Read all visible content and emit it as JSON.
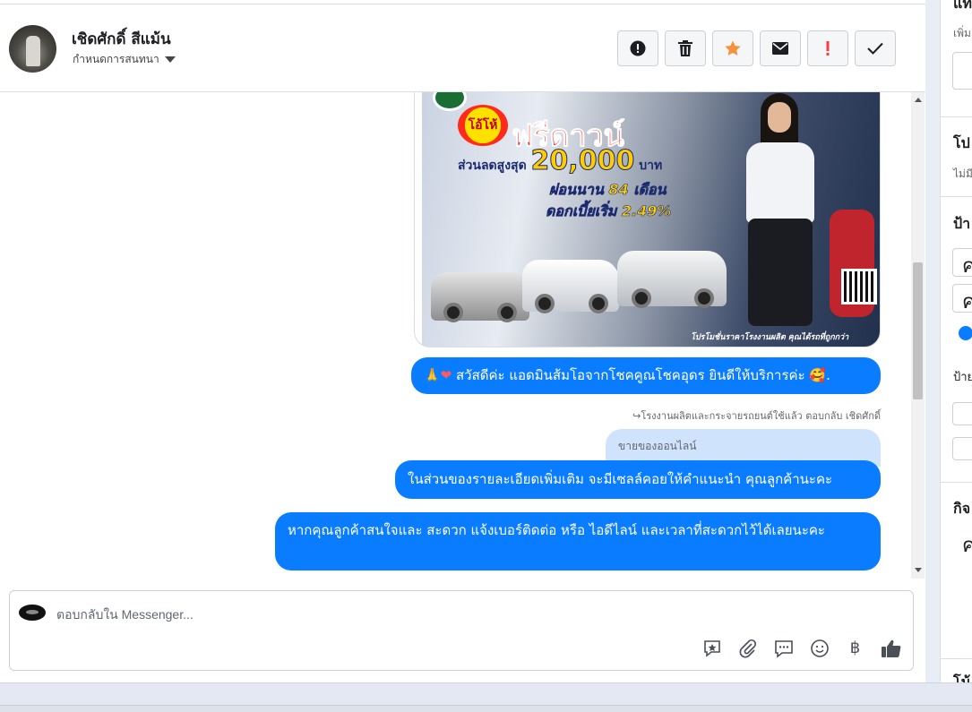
{
  "header": {
    "contact_name": "เชิดศักดิ์ สีแม้น",
    "assign_label": "กำหนดการสนทนา",
    "actions": [
      {
        "name": "report-button",
        "icon": "alert-circle-icon"
      },
      {
        "name": "delete-button",
        "icon": "trash-icon"
      },
      {
        "name": "star-button",
        "icon": "star-icon"
      },
      {
        "name": "mark-unread-button",
        "icon": "envelope-icon"
      },
      {
        "name": "follow-up-button",
        "icon": "exclamation-icon"
      },
      {
        "name": "done-button",
        "icon": "checkmark-icon"
      }
    ]
  },
  "promo": {
    "free_down_tag": "โอ้โห้",
    "headline": "ฟรีดาวน์",
    "discount_label": "ส่วนลดสูงสุด",
    "discount_amount": "20,000",
    "discount_unit": "บาท",
    "installment": "ผ่อนนาน 84 เดือน",
    "interest": "ดอกเบี้ยเริ่ม 2.49%",
    "footer": "โปรโมชั่นราคาโรงงานผลิต คุณได้รถที่ถูกกว่า"
  },
  "messages": {
    "greeting_emoji": "🙏❤",
    "greeting": "สวัสดีค่ะ แอดมินส้มโอจากโชคคูณโชคอุดร ยินดีให้บริการค่ะ",
    "greeting_end": "🥰.",
    "reply_meta": "↪โรงงานผลิตและกระจายรถยนต์ใช้แล้ว ตอบกลับ เชิดศักดิ์",
    "quoted_text": "ขายของออนไลน์",
    "msg2": "ในส่วนของรายละเอียดเพิ่มเติม จะมีเซลล์คอยให้คำแนะนำ คุณลูกค้านะคะ",
    "msg3": "หากคุณลูกค้าสนใจและ สะดวก แจ้งเบอร์ติดต่อ หรือ ไอดีไลน์ และเวลาที่สะดวกไว้ได้เลยนะคะ"
  },
  "composer": {
    "placeholder": "ตอบกลับใน Messenger...",
    "tools": [
      "sticker-icon",
      "paperclip-icon",
      "saved-replies-icon",
      "emoji-icon",
      "baht-icon",
      "thumbs-up-icon"
    ],
    "baht_glyph": "฿"
  },
  "right_panel": {
    "t1": "แท",
    "s1": "เพิ่ม",
    "t2": "โป",
    "s2": "ไม่มี",
    "t3": "ป้า",
    "g1": "ค",
    "g2": "ค",
    "s3": "ป้าย",
    "t4": "กิจ",
    "g3": "ค",
    "t5": "โน้"
  },
  "colors": {
    "messenger_blue": "#0a7cff",
    "quoted_bg": "#cfe3fd",
    "star_orange": "#f7923a",
    "alert_red": "#fa3e3e"
  }
}
